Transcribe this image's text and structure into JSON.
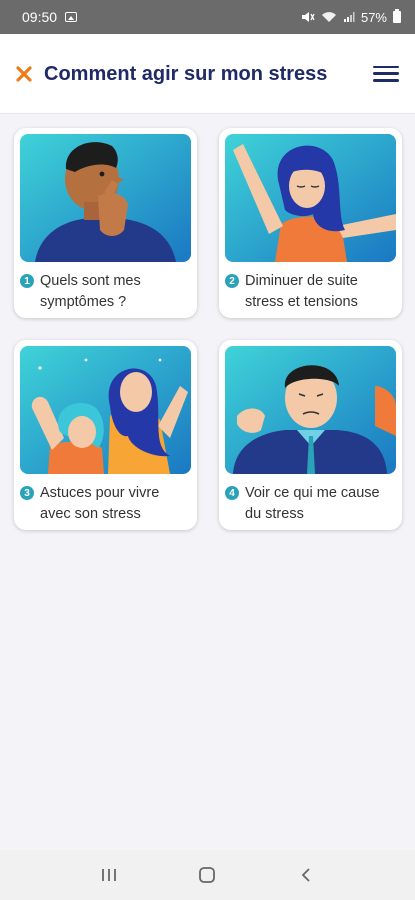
{
  "status_bar": {
    "time": "09:50",
    "battery": "57%"
  },
  "header": {
    "title": "Comment agir sur mon stress",
    "close_icon": "close-icon",
    "menu_icon": "hamburger-menu-icon",
    "accent_color": "#f07a1a",
    "title_color": "#1f2a66"
  },
  "cards": [
    {
      "number": "1",
      "label": "Quels sont mes symptômes ?",
      "illustration": "thinking-man"
    },
    {
      "number": "2",
      "label": "Diminuer de suite stress et tensions",
      "illustration": "stretching-woman"
    },
    {
      "number": "3",
      "label": "Astuces pour vivre avec son stress",
      "illustration": "strong-women"
    },
    {
      "number": "4",
      "label": "Voir ce qui me cause du stress",
      "illustration": "worried-man"
    }
  ],
  "nav_bar": {
    "recent_icon": "recent-apps-icon",
    "home_icon": "home-icon",
    "back_icon": "back-icon"
  }
}
